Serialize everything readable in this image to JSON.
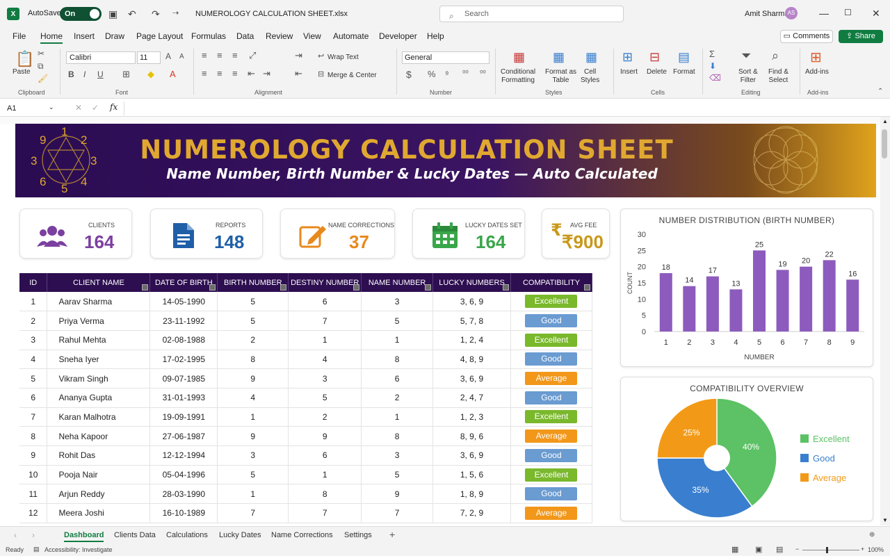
{
  "app": {
    "logo": "X",
    "autosave_label": "AutoSave",
    "autosave_state": "On",
    "filename": "NUMEROLOGY CALCULATION SHEET.xlsx",
    "search_placeholder": "Search",
    "user_name": "Amit Sharma",
    "user_initials": "AS"
  },
  "menu": [
    "File",
    "Home",
    "Insert",
    "Draw",
    "Page Layout",
    "Formulas",
    "Data",
    "Review",
    "View",
    "Automate",
    "Developer",
    "Help"
  ],
  "menu_active": "Home",
  "comments_label": "Comments",
  "share_label": "Share",
  "ribbon": {
    "paste": "Paste",
    "clipboard": "Clipboard",
    "font_name": "Calibri",
    "font_size": "11",
    "font_group": "Font",
    "alignment_group": "Alignment",
    "wrap_text": "Wrap Text",
    "merge_center": "Merge & Center",
    "number_format": "General",
    "number_group": "Number",
    "conditional": "Conditional\nFormatting",
    "format_table": "Format as\nTable",
    "cell_styles": "Cell\nStyles",
    "styles_group": "Styles",
    "insert": "Insert",
    "delete": "Delete",
    "format": "Format",
    "cells_group": "Cells",
    "sort_filter": "Sort &\nFilter",
    "find_select": "Find &\nSelect",
    "editing_group": "Editing",
    "addins": "Add-ins",
    "addins_group": "Add-ins"
  },
  "namebox": "A1",
  "banner": {
    "title": "NUMEROLOGY CALCULATION SHEET",
    "subtitle": "Name Number, Birth Number & Lucky Dates — Auto Calculated",
    "wheel_numbers": [
      "1",
      "2",
      "3",
      "4",
      "5",
      "6",
      "3",
      "9"
    ]
  },
  "kpis": [
    {
      "label": "CLIENTS",
      "value": "164",
      "color": "#7b3fa0"
    },
    {
      "label": "REPORTS",
      "value": "148",
      "color": "#1f5fa8"
    },
    {
      "label": "NAME CORRECTIONS",
      "value": "37",
      "color": "#e8891c"
    },
    {
      "label": "LUCKY DATES SET",
      "value": "164",
      "color": "#3aa64a"
    },
    {
      "label": "AVG FEE",
      "value": "₹900",
      "color": "#c9981a"
    }
  ],
  "table": {
    "headers": [
      "ID",
      "CLIENT NAME",
      "DATE OF BIRTH",
      "BIRTH NUMBER",
      "DESTINY NUMBER",
      "NAME NUMBER",
      "LUCKY NUMBERS",
      "COMPATIBILITY"
    ],
    "rows": [
      [
        "1",
        "Aarav Sharma",
        "14-05-1990",
        "5",
        "6",
        "3",
        "3, 6, 9",
        "Excellent"
      ],
      [
        "2",
        "Priya Verma",
        "23-11-1992",
        "5",
        "7",
        "5",
        "5, 7, 8",
        "Good"
      ],
      [
        "3",
        "Rahul Mehta",
        "02-08-1988",
        "2",
        "1",
        "1",
        "1, 2, 4",
        "Excellent"
      ],
      [
        "4",
        "Sneha Iyer",
        "17-02-1995",
        "8",
        "4",
        "8",
        "4, 8, 9",
        "Good"
      ],
      [
        "5",
        "Vikram Singh",
        "09-07-1985",
        "9",
        "3",
        "6",
        "3, 6, 9",
        "Average"
      ],
      [
        "6",
        "Ananya Gupta",
        "31-01-1993",
        "4",
        "5",
        "2",
        "2, 4, 7",
        "Good"
      ],
      [
        "7",
        "Karan Malhotra",
        "19-09-1991",
        "1",
        "2",
        "1",
        "1, 2, 3",
        "Excellent"
      ],
      [
        "8",
        "Neha Kapoor",
        "27-06-1987",
        "9",
        "9",
        "8",
        "8, 9, 6",
        "Average"
      ],
      [
        "9",
        "Rohit Das",
        "12-12-1994",
        "3",
        "6",
        "3",
        "3, 6, 9",
        "Good"
      ],
      [
        "10",
        "Pooja Nair",
        "05-04-1996",
        "5",
        "1",
        "5",
        "1, 5, 6",
        "Excellent"
      ],
      [
        "11",
        "Arjun Reddy",
        "28-03-1990",
        "1",
        "8",
        "9",
        "1, 8, 9",
        "Good"
      ],
      [
        "12",
        "Meera Joshi",
        "16-10-1989",
        "7",
        "7",
        "7",
        "7, 2, 9",
        "Average"
      ]
    ]
  },
  "badge_colors": {
    "Excellent": "#7ab82c",
    "Good": "#6a9bd1",
    "Average": "#f2971a"
  },
  "chart_data": [
    {
      "type": "bar",
      "title": "NUMBER DISTRIBUTION (BIRTH NUMBER)",
      "xlabel": "NUMBER",
      "ylabel": "COUNT",
      "categories": [
        "1",
        "2",
        "3",
        "4",
        "5",
        "6",
        "7",
        "8",
        "9"
      ],
      "values": [
        18,
        14,
        17,
        13,
        25,
        19,
        20,
        22,
        16
      ],
      "ylim": [
        0,
        30
      ],
      "yticks": [
        "0",
        "5",
        "10",
        "15",
        "20",
        "25",
        "30"
      ],
      "color": "#8d5bbd",
      "grid": false
    },
    {
      "type": "pie",
      "title": "COMPATIBILITY OVERVIEW",
      "labels": [
        "Excellent",
        "Good",
        "Average"
      ],
      "values": [
        40,
        35,
        25
      ],
      "value_labels": [
        "40%",
        "35%",
        "25%"
      ],
      "colors": [
        "#5cc265",
        "#3a7fcf",
        "#f29a17"
      ],
      "legend": "right"
    }
  ],
  "sheet_tabs": [
    "Dashboard",
    "Clients Data",
    "Calculations",
    "Lucky Dates",
    "Name Corrections",
    "Settings"
  ],
  "active_tab": "Dashboard",
  "status": {
    "ready": "Ready",
    "accessibility": "Accessibility: Investigate",
    "zoom": "100%"
  }
}
